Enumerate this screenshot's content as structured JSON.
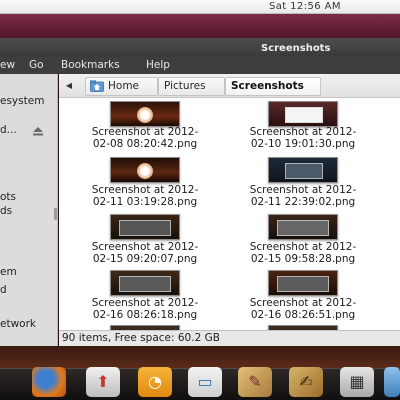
{
  "panel": {
    "clock": "Sat 12:56 AM"
  },
  "window": {
    "title": "Screenshots",
    "menu": [
      "ew",
      "Go",
      "Bookmarks",
      "Help"
    ]
  },
  "sidebar": {
    "items": [
      {
        "label": "esystem",
        "icon": "filesystem-icon"
      },
      {
        "label": "d...",
        "icon": "drive-icon"
      },
      {
        "label": "ots",
        "icon": "folder-icon"
      },
      {
        "label": "ds",
        "icon": "folder-icon"
      },
      {
        "label": "em",
        "icon": "drive-icon"
      },
      {
        "label": "d",
        "icon": "drive-icon"
      },
      {
        "label": "etwork",
        "icon": "network-icon"
      }
    ]
  },
  "pathbar": {
    "crumbs": [
      "Home",
      "Pictures",
      "Screenshots"
    ]
  },
  "files": [
    {
      "line1": "Screenshot at 2012-",
      "line2": "02-08 08:20:42.png",
      "style": "fox-dark"
    },
    {
      "line1": "Screenshot at 2012-",
      "line2": "02-10 19:01:30.png",
      "style": "white-dialog"
    },
    {
      "line1": "Screenshot at 2012-",
      "line2": "02-11 03:19:28.png",
      "style": "fox-dark"
    },
    {
      "line1": "Screenshot at 2012-",
      "line2": "02-11 22:39:02.png",
      "style": "dark-desktop"
    },
    {
      "line1": "Screenshot at 2012-",
      "line2": "02-15 09:20:07.png",
      "style": "dark-windows"
    },
    {
      "line1": "Screenshot at 2012-",
      "line2": "02-15 09:58:28.png",
      "style": "dark-windows"
    },
    {
      "line1": "Screenshot at 2012-",
      "line2": "02-16 08:26:18.png",
      "style": "dark-windows"
    },
    {
      "line1": "Screenshot at 2012-",
      "line2": "02-16 08:26:51.png",
      "style": "dark-windows"
    }
  ],
  "status": {
    "text": "90 items, Free space: 60.2 GB"
  },
  "dock": {
    "icons": [
      {
        "name": "firefox-icon",
        "color": "#e07a1f"
      },
      {
        "name": "update-manager-icon",
        "color": "#d9d9d9"
      },
      {
        "name": "spreadsheet-icon",
        "color": "#f29a1a"
      },
      {
        "name": "presentation-icon",
        "color": "#2e73b8"
      },
      {
        "name": "paint-icon",
        "color": "#c69a55"
      },
      {
        "name": "text-editor-icon",
        "color": "#b98a44"
      },
      {
        "name": "calculator-icon",
        "color": "#bdbdbd"
      },
      {
        "name": "app-icon",
        "color": "#6aa5d6"
      }
    ]
  }
}
